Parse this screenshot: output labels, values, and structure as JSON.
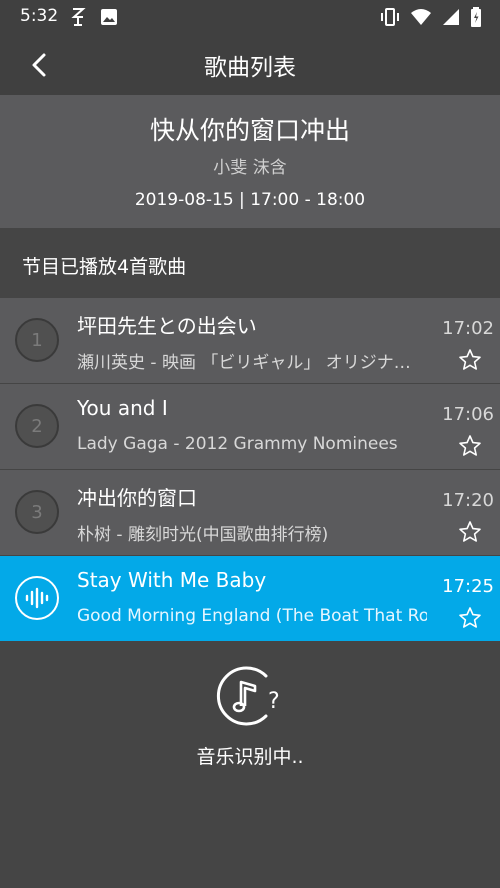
{
  "status_bar": {
    "time": "5:32"
  },
  "toolbar": {
    "title": "歌曲列表"
  },
  "program": {
    "title": "快从你的窗口冲出",
    "hosts": "小斐 沫含",
    "schedule": "2019-08-15 | 17:00 - 18:00"
  },
  "section": {
    "label": "节目已播放4首歌曲"
  },
  "songs": [
    {
      "index": "1",
      "title": "坪田先生との出会い",
      "meta": "瀬川英史 - 映画 「ビリギャル」 オリジナル・サウンドトラック",
      "time": "17:02",
      "playing": false
    },
    {
      "index": "2",
      "title": "You and I",
      "meta": "Lady Gaga - 2012 Grammy Nominees",
      "time": "17:06",
      "playing": false
    },
    {
      "index": "3",
      "title": "冲出你的窗口",
      "meta": "朴树 - 雕刻时光(中国歌曲排行榜)",
      "time": "17:20",
      "playing": false
    },
    {
      "index": "",
      "title": "Stay With Me Baby",
      "meta": "Good Morning England (The Boat That Ro",
      "time": "17:25",
      "playing": true
    }
  ],
  "recognize": {
    "label": "音乐识别中.."
  },
  "colors": {
    "accent": "#03a9e8",
    "row_bg": "#5b5b5d",
    "page_bg": "#454545"
  }
}
